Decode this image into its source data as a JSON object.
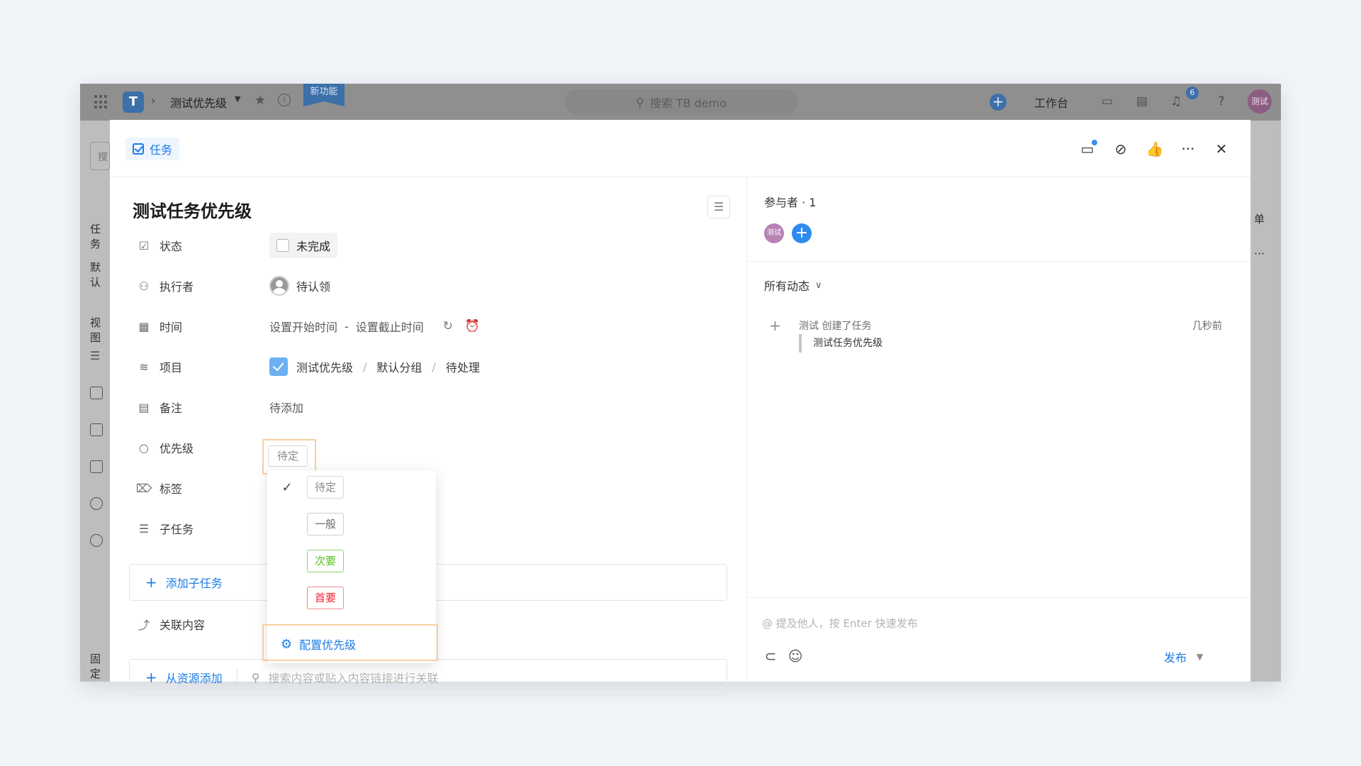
{
  "topbar": {
    "project_name": "测试优先级",
    "new_feature_badge": "新功能",
    "search_placeholder": "搜索 TB demo",
    "workbench": "工作台",
    "notification_count": "6",
    "user_avatar": "测试"
  },
  "background": {
    "search_hint": "搜",
    "sidebar_task": "任务",
    "sidebar_default": "默认",
    "sidebar_view": "视图",
    "sidebar_fixed": "固定",
    "right_strip_label": "单"
  },
  "modal": {
    "type_label": "任务",
    "title": "测试任务优先级",
    "fields": {
      "status": {
        "label": "状态",
        "value": "未完成"
      },
      "assignee": {
        "label": "执行者",
        "value": "待认领"
      },
      "time": {
        "label": "时间",
        "start": "设置开始时间",
        "dash": "-",
        "end": "设置截止时间"
      },
      "project": {
        "label": "项目",
        "project": "测试优先级",
        "group": "默认分组",
        "column": "待处理"
      },
      "note": {
        "label": "备注",
        "value": "待添加"
      },
      "priority": {
        "label": "优先级",
        "value": "待定"
      },
      "tags": {
        "label": "标签"
      },
      "subtasks": {
        "label": "子任务"
      },
      "related": {
        "label": "关联内容"
      }
    },
    "add_subtask": "添加子任务",
    "add_from_resource": "从资源添加",
    "resource_search_placeholder": "搜索内容或贴入内容链接进行关联",
    "priority_dropdown": {
      "options": [
        {
          "label": "待定",
          "selected": true,
          "color": "#8a8a8a",
          "border": "#d9d9d9"
        },
        {
          "label": "一般",
          "selected": false,
          "color": "#6a6a6a",
          "border": "#cfcfcf"
        },
        {
          "label": "次要",
          "selected": false,
          "color": "#52c41a",
          "border": "#8fd46a"
        },
        {
          "label": "首要",
          "selected": false,
          "color": "#f5222d",
          "border": "#f08a8f"
        }
      ],
      "config_label": "配置优先级"
    }
  },
  "right_pane": {
    "participants": "参与者 · 1",
    "participant_avatar": "测试",
    "activity_filter": "所有动态",
    "activity": {
      "text": "测试 创建了任务",
      "time": "几秒前",
      "quote": "测试任务优先级"
    },
    "comment_placeholder": "@ 提及他人，按 Enter 快速发布",
    "publish": "发布"
  },
  "colors": {
    "accent": "#1b7be6",
    "highlight_border": "#f6cf9f"
  }
}
